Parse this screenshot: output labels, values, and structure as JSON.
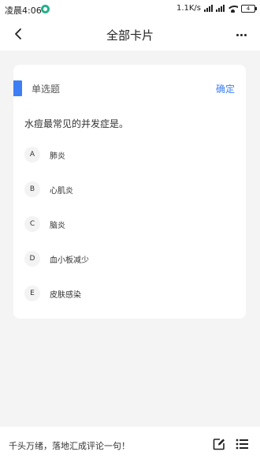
{
  "status_bar": {
    "time": "凌晨4:06",
    "network_speed": "1.1K/s",
    "battery": "4"
  },
  "nav": {
    "title": "全部卡片"
  },
  "card": {
    "question_type": "单选题",
    "confirm_label": "确定",
    "question": "水痘最常见的并发症是。",
    "options": [
      {
        "letter": "A",
        "text": "肺炎"
      },
      {
        "letter": "B",
        "text": "心肌炎"
      },
      {
        "letter": "C",
        "text": "脑炎"
      },
      {
        "letter": "D",
        "text": "血小板减少"
      },
      {
        "letter": "E",
        "text": "皮肤感染"
      }
    ]
  },
  "bottom_bar": {
    "comment_placeholder": "千头万绪，落地汇成评论一句！"
  },
  "colors": {
    "accent": "#3d7ef5",
    "background": "#f4f4f4",
    "status_dot": "#27b08a"
  }
}
